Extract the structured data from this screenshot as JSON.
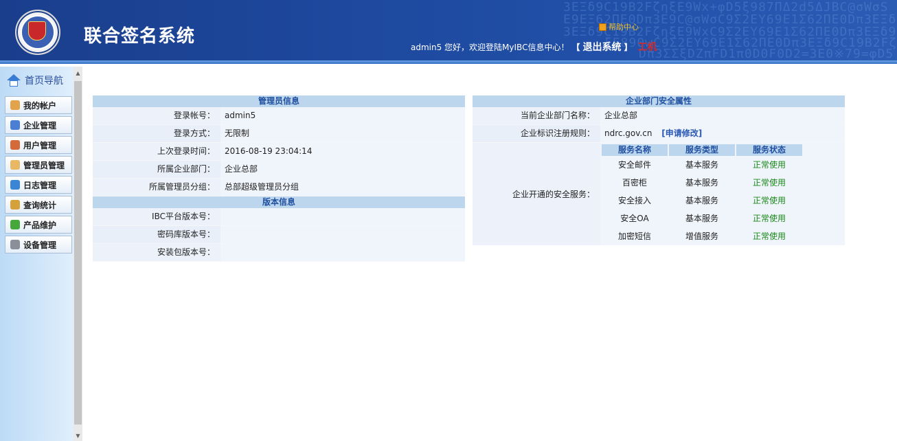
{
  "header": {
    "title": "联合签名系统",
    "help_label": "帮助中心",
    "welcome_text": "admin5 您好，欢迎登陆MyIBC信息中心！",
    "bracket_open": "【",
    "logout_label": "退出系统",
    "bracket_close": "】",
    "extra_text": "工机",
    "deco_lines": [
      "3EΞδ9C19B2FζηξE9Wx+φD5ξ987ΠΔ2d5ΔJBC@σWσS",
      "E9EΞ62ΠE0Dπ3E9C@σWσC9Σ2EY69E1Σ62ΠE0Dπ3EΞδ9C19",
      "3EΞδ9C19B2FζηξE9WxC9Σ2EY69E1Σ62ΠE0Dπ3EΞδ9C19B2",
      "ξE890wC9Σ2EY69E1Σ62ΠE0Dπ3EΞδ9C19B2FζηξE890w",
      "Dπ3ΣΣξDZπFD1π0D0F0D2=3E0※79=φD5"
    ]
  },
  "sidebar": {
    "home_label": "首页导航",
    "items": [
      {
        "label": "我的帐户",
        "icon": "user-icon",
        "color": "#e2a34a"
      },
      {
        "label": "企业管理",
        "icon": "enterprise-icon",
        "color": "#4a7fd4"
      },
      {
        "label": "用户管理",
        "icon": "users-icon",
        "color": "#d46a3a"
      },
      {
        "label": "管理员管理",
        "icon": "admin-icon",
        "color": "#e8b864"
      },
      {
        "label": "日志管理",
        "icon": "log-icon",
        "color": "#3a86d4"
      },
      {
        "label": "查询统计",
        "icon": "stats-icon",
        "color": "#d4a13a"
      },
      {
        "label": "产品维护",
        "icon": "product-icon",
        "color": "#46a83a"
      },
      {
        "label": "设备管理",
        "icon": "device-icon",
        "color": "#8a8f99"
      }
    ]
  },
  "admin_info": {
    "heading": "管理员信息",
    "rows": [
      {
        "label": "登录帐号：",
        "value": "admin5"
      },
      {
        "label": "登录方式：",
        "value": "无限制"
      },
      {
        "label": "上次登录时间：",
        "value": "2016-08-19 23:04:14"
      },
      {
        "label": "所属企业部门：",
        "value": "企业总部"
      },
      {
        "label": "所属管理员分组：",
        "value": "总部超级管理员分组"
      }
    ]
  },
  "version_info": {
    "heading": "版本信息",
    "rows": [
      {
        "label": "IBC平台版本号：",
        "value": ""
      },
      {
        "label": "密码库版本号：",
        "value": ""
      },
      {
        "label": "安装包版本号：",
        "value": ""
      }
    ]
  },
  "security": {
    "heading": "企业部门安全属性",
    "dept_label": "当前企业部门名称：",
    "dept_value": "企业总部",
    "rule_label": "企业标识注册规则：",
    "rule_value": "ndrc.gov.cn",
    "apply_label": "[申请修改]",
    "services_label": "企业开通的安全服务：",
    "columns": [
      "服务名称",
      "服务类型",
      "服务状态"
    ],
    "services": [
      {
        "name": "安全邮件",
        "type": "基本服务",
        "status": "正常使用"
      },
      {
        "name": "百密柜",
        "type": "基本服务",
        "status": "正常使用"
      },
      {
        "name": "安全接入",
        "type": "基本服务",
        "status": "正常使用"
      },
      {
        "name": "安全OA",
        "type": "基本服务",
        "status": "正常使用"
      },
      {
        "name": "加密短信",
        "type": "增值服务",
        "status": "正常使用"
      }
    ]
  }
}
